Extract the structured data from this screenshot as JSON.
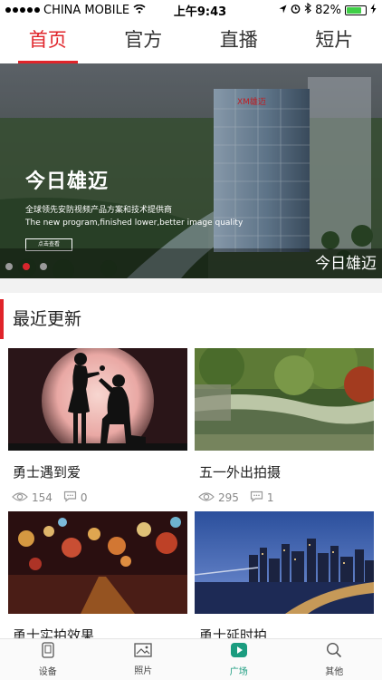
{
  "status": {
    "carrier": "CHINA MOBILE",
    "time": "上午9:43",
    "battery": "82%"
  },
  "tabs": [
    "首页",
    "官方",
    "直播",
    "短片"
  ],
  "banner": {
    "title": "今日雄迈",
    "subtitle_cn": "全球领先安防视频产品方案和技术提供商",
    "subtitle_en": "The new program,finished lower,better image quality",
    "button": "点击查看",
    "sign": "XM雄迈",
    "caption": "今日雄迈",
    "page_count": 3,
    "active_page": 2
  },
  "section": {
    "title": "最近更新"
  },
  "cards": [
    {
      "title": "勇士遇到爱",
      "views": "154",
      "comments": "0"
    },
    {
      "title": "五一外出拍摄",
      "views": "295",
      "comments": "1"
    },
    {
      "title": "勇士实拍效果",
      "views": "",
      "comments": ""
    },
    {
      "title": "勇士延时拍",
      "views": "",
      "comments": ""
    }
  ],
  "bottom_nav": [
    {
      "label": "设备",
      "icon": "device-icon"
    },
    {
      "label": "照片",
      "icon": "photo-icon"
    },
    {
      "label": "广场",
      "icon": "play-icon"
    },
    {
      "label": "其他",
      "icon": "search-icon"
    }
  ],
  "colors": {
    "accent": "#e0242a",
    "nav_active": "#1a9c7f"
  }
}
